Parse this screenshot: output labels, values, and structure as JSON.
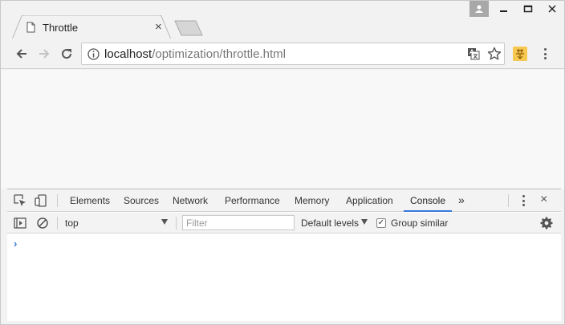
{
  "tab": {
    "title": "Throttle",
    "close_glyph": "×"
  },
  "omnibox": {
    "host": "localhost",
    "path": "/optimization/throttle.html"
  },
  "devtools": {
    "tabs": [
      {
        "label": "Elements"
      },
      {
        "label": "Sources"
      },
      {
        "label": "Network"
      },
      {
        "label": "Performance"
      },
      {
        "label": "Memory"
      },
      {
        "label": "Application"
      },
      {
        "label": "Console"
      }
    ],
    "active_tab": "Console",
    "more_glyph": "»",
    "close_glyph": "×"
  },
  "console": {
    "context": "top",
    "filter_placeholder": "Filter",
    "levels": "Default levels",
    "group_similar_label": "Group similar",
    "group_similar_checked": true,
    "check_glyph": "✓",
    "prompt_glyph": "›"
  },
  "colors": {
    "accent": "#3879d9",
    "extension_bg": "#f6c850",
    "page_bg": "#f8f8f8"
  }
}
